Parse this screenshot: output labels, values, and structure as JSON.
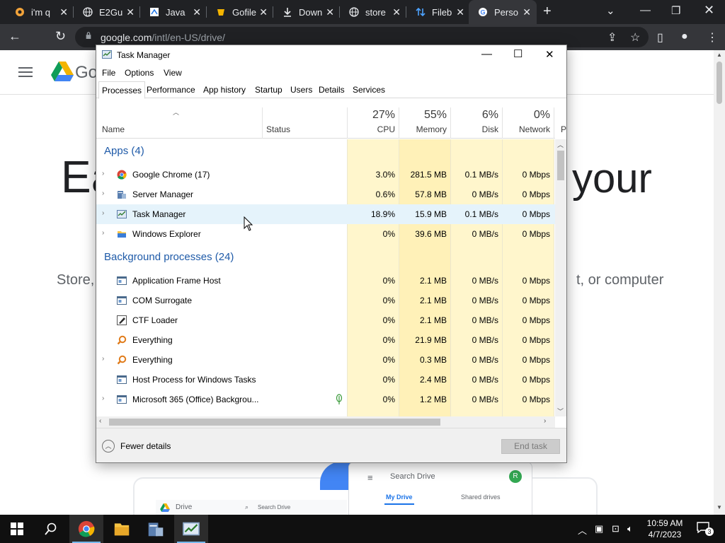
{
  "browser": {
    "tabs": [
      {
        "title": "i'm q",
        "icon": "ai-chat-icon"
      },
      {
        "title": "E2Gu",
        "icon": "globe-icon"
      },
      {
        "title": "Java",
        "icon": "java-page-icon"
      },
      {
        "title": "Gofile",
        "icon": "gofile-icon"
      },
      {
        "title": "Down",
        "icon": "download-icon"
      },
      {
        "title": "store",
        "icon": "globe-icon"
      },
      {
        "title": "Fileb",
        "icon": "filebin-icon"
      },
      {
        "title": "Perso",
        "icon": "google-icon",
        "active": true
      }
    ],
    "new_tab": "+",
    "url_host": "google.com",
    "url_path": "/intl/en-US/drive/"
  },
  "page": {
    "logo_text": "Go",
    "hero_left": "Ea",
    "hero_right": "your",
    "sub_left": "Store,",
    "sub_right": "t, or computer",
    "phone_search": "Search Drive",
    "phone_avatar": "R",
    "phone_my_drive": "My Drive",
    "phone_shared": "Shared drives",
    "laptop_title": "Drive",
    "laptop_search": "Search Drive"
  },
  "task_manager": {
    "title": "Task Manager",
    "menu": [
      "File",
      "Options",
      "View"
    ],
    "tabs": [
      "Processes",
      "Performance",
      "App history",
      "Startup",
      "Users",
      "Details",
      "Services"
    ],
    "active_tab": "Processes",
    "columns": {
      "name": "Name",
      "status": "Status",
      "cpu_pct": "27%",
      "cpu": "CPU",
      "mem_pct": "55%",
      "mem": "Memory",
      "disk_pct": "6%",
      "disk": "Disk",
      "net_pct": "0%",
      "net": "Network",
      "power_partial": "P"
    },
    "groups": {
      "apps": "Apps (4)",
      "background": "Background processes (24)"
    },
    "apps": [
      {
        "name": "Google Chrome (17)",
        "cpu": "3.0%",
        "mem": "281.5 MB",
        "disk": "0.1 MB/s",
        "net": "0 Mbps",
        "icon": "chrome-icon",
        "expandable": true
      },
      {
        "name": "Server Manager",
        "cpu": "0.6%",
        "mem": "57.8 MB",
        "disk": "0 MB/s",
        "net": "0 Mbps",
        "icon": "server-manager-icon",
        "expandable": true
      },
      {
        "name": "Task Manager",
        "cpu": "18.9%",
        "mem": "15.9 MB",
        "disk": "0.1 MB/s",
        "net": "0 Mbps",
        "icon": "task-manager-icon",
        "expandable": true,
        "highlighted": true
      },
      {
        "name": "Windows Explorer",
        "cpu": "0%",
        "mem": "39.6 MB",
        "disk": "0 MB/s",
        "net": "0 Mbps",
        "icon": "folder-icon",
        "expandable": true
      }
    ],
    "background": [
      {
        "name": "Application Frame Host",
        "cpu": "0%",
        "mem": "2.1 MB",
        "disk": "0 MB/s",
        "net": "0 Mbps",
        "icon": "app-window-icon",
        "expandable": false
      },
      {
        "name": "COM Surrogate",
        "cpu": "0%",
        "mem": "2.1 MB",
        "disk": "0 MB/s",
        "net": "0 Mbps",
        "icon": "app-window-icon",
        "expandable": false
      },
      {
        "name": "CTF Loader",
        "cpu": "0%",
        "mem": "2.1 MB",
        "disk": "0 MB/s",
        "net": "0 Mbps",
        "icon": "ctf-pen-icon",
        "expandable": false
      },
      {
        "name": "Everything",
        "cpu": "0%",
        "mem": "21.9 MB",
        "disk": "0 MB/s",
        "net": "0 Mbps",
        "icon": "magnifier-icon",
        "expandable": false
      },
      {
        "name": "Everything",
        "cpu": "0%",
        "mem": "0.3 MB",
        "disk": "0 MB/s",
        "net": "0 Mbps",
        "icon": "magnifier-icon",
        "expandable": true
      },
      {
        "name": "Host Process for Windows Tasks",
        "cpu": "0%",
        "mem": "2.4 MB",
        "disk": "0 MB/s",
        "net": "0 Mbps",
        "icon": "app-window-icon",
        "expandable": false
      },
      {
        "name": "Microsoft 365 (Office) Backgrou...",
        "cpu": "0%",
        "mem": "1.2 MB",
        "disk": "0 MB/s",
        "net": "0 Mbps",
        "icon": "app-window-icon",
        "expandable": true,
        "leaf": true
      }
    ],
    "fewer_details": "Fewer details",
    "end_task": "End task"
  },
  "taskbar": {
    "time": "10:59 AM",
    "date": "4/7/2023",
    "notifications": "3",
    "pinned": [
      "start-icon",
      "search-icon",
      "chrome-icon",
      "file-explorer-icon",
      "server-manager-icon",
      "task-manager-icon"
    ]
  }
}
